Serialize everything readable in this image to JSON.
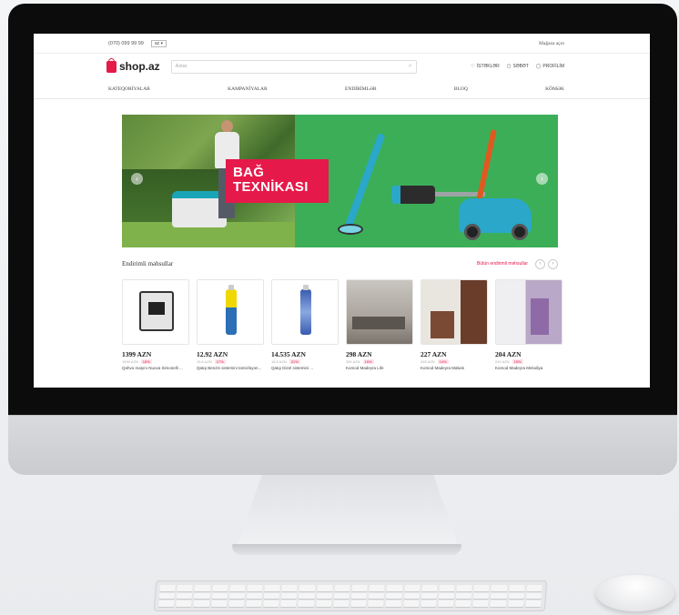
{
  "topbar": {
    "phone": "(070) 099 99 99",
    "lang": "az ▾",
    "right": "Mağaza açın"
  },
  "header": {
    "logo": "shop.az",
    "search_placeholder": "Axtar",
    "links": [
      "İSTƏKLƏR",
      "SƏBƏT",
      "PROFİLİM"
    ]
  },
  "nav": {
    "items": [
      "KATEQORİYALAR",
      "KAMPANİYALAR",
      "ENDİRİMLƏR",
      "BLOQ",
      "KÖMƏK"
    ]
  },
  "banner": {
    "tag_line1": "BAĞ",
    "tag_line2": "TEXNİKASI"
  },
  "section": {
    "title": "Endirimli məhsullar",
    "link": "Bütün endirimli məhsullar"
  },
  "products": [
    {
      "price": "1399 AZN",
      "old": "1699 AZN",
      "disc": "18%",
      "name": "Qəhvə maşını Nuova Simonelli ..."
    },
    {
      "price": "12.92 AZN",
      "old": "15.6 AZN",
      "disc": "17%",
      "name": "Qatqı Benzin sistemini təmizləyən..."
    },
    {
      "price": "14.535 AZN",
      "old": "18.5 AZN",
      "disc": "21%",
      "name": "Qatqı Dizel sistemini ..."
    },
    {
      "price": "298 AZN",
      "old": "350 AZN",
      "disc": "15%",
      "name": "Komod Madeyra Life"
    },
    {
      "price": "227 AZN",
      "old": "265 AZN",
      "disc": "14%",
      "name": "Komod Madeyra Malwin"
    },
    {
      "price": "204 AZN",
      "old": "240 AZN",
      "disc": "15%",
      "name": "Komod Madeyra Melodiya"
    }
  ],
  "colors": {
    "brand": "#e5194a",
    "banner": "#3cae58"
  }
}
